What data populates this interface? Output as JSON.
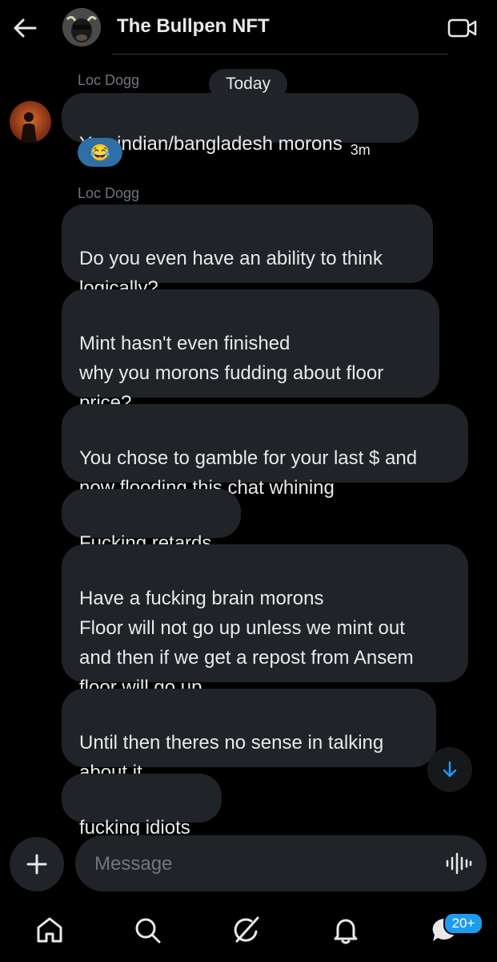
{
  "header": {
    "title": "The Bullpen NFT",
    "back_icon": "arrow-left-icon",
    "video_icon": "video-camera-icon"
  },
  "day_separator": "Today",
  "group1": {
    "sender": "Loc Dogg",
    "message": "You indian/bangladesh morons",
    "time": "3m",
    "reaction": "😂"
  },
  "group2": {
    "sender": "Loc Dogg",
    "messages": [
      "Do you even have an ability to think\nlogically?",
      "Mint hasn't even finished\nwhy you morons fudding about floor\nprice?",
      "You chose to gamble for your last $ and\nnow flooding this chat whining",
      "Fucking retards",
      "Have a fucking brain morons\nFloor will not go up unless we mint out\nand then if we get a repost from Ansem\nfloor will go up",
      "Until then theres no sense in talking\nabout it",
      "fucking idiots"
    ]
  },
  "composer": {
    "placeholder": "Message",
    "plus_icon": "plus-icon",
    "voice_icon": "voice-waveform-icon"
  },
  "nav": {
    "items": [
      "home-icon",
      "search-icon",
      "grok-icon",
      "notifications-bell-icon",
      "messages-icon"
    ],
    "messages_badge": "20+"
  },
  "colors": {
    "background": "#000000",
    "bubble": "#202327",
    "accent": "#1d9bf0",
    "muted": "#71767b"
  }
}
